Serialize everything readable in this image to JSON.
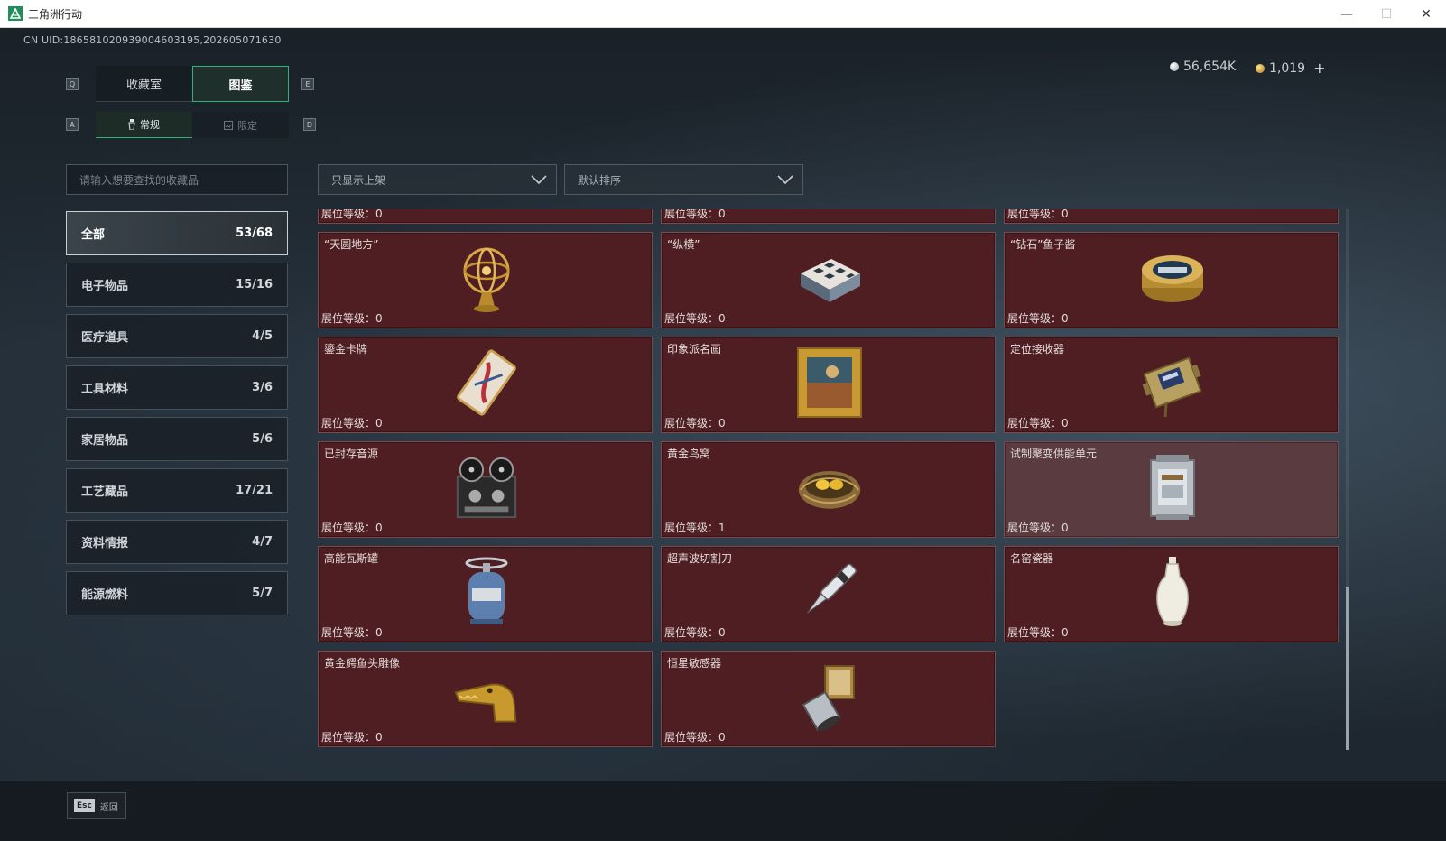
{
  "window": {
    "title": "三角洲行动",
    "minimize": "—",
    "maximize": "☐",
    "close": "✕"
  },
  "uid_text": "CN UID:18658102093900460319​5,202605071630",
  "currency": {
    "silver": "56,654K",
    "gold": "1,019",
    "add": "+"
  },
  "keys": {
    "q": "Q",
    "e": "E",
    "a": "A",
    "d": "D"
  },
  "tabs": [
    {
      "label": "收藏室"
    },
    {
      "label": "图鉴"
    }
  ],
  "subtabs": [
    {
      "label": "常规"
    },
    {
      "label": "限定"
    }
  ],
  "search": {
    "placeholder": "请输入想要查找的收藏品"
  },
  "filters": {
    "display": "只显示上架",
    "sort": "默认排序"
  },
  "categories": [
    {
      "label": "全部",
      "count": "53/68"
    },
    {
      "label": "电子物品",
      "count": "15/16"
    },
    {
      "label": "医疗道具",
      "count": "4/5"
    },
    {
      "label": "工具材料",
      "count": "3/6"
    },
    {
      "label": "家居物品",
      "count": "5/6"
    },
    {
      "label": "工艺藏品",
      "count": "17/21"
    },
    {
      "label": "资料情报",
      "count": "4/7"
    },
    {
      "label": "能源燃料",
      "count": "5/7"
    }
  ],
  "level_label": "展位等级：",
  "top_partial_levels": [
    "0",
    "0",
    "0"
  ],
  "items": [
    {
      "name": "“天圆地方”",
      "level": "0",
      "icon": "armillary-sphere-icon"
    },
    {
      "name": "“纵横”",
      "level": "0",
      "icon": "chess-box-icon"
    },
    {
      "name": "“钻石”鱼子酱",
      "level": "0",
      "icon": "caviar-tin-icon"
    },
    {
      "name": "鎏金卡牌",
      "level": "0",
      "icon": "gilded-card-icon"
    },
    {
      "name": "印象派名画",
      "level": "0",
      "icon": "framed-painting-icon"
    },
    {
      "name": "定位接收器",
      "level": "0",
      "icon": "locator-receiver-icon"
    },
    {
      "name": "已封存音源",
      "level": "0",
      "icon": "reel-recorder-icon"
    },
    {
      "name": "黄金鸟窝",
      "level": "1",
      "icon": "golden-nest-icon"
    },
    {
      "name": "试制聚变供能单元",
      "level": "0",
      "icon": "fusion-cell-icon"
    },
    {
      "name": "高能瓦斯罐",
      "level": "0",
      "icon": "gas-canister-icon"
    },
    {
      "name": "超声波切割刀",
      "level": "0",
      "icon": "ultrasonic-knife-icon"
    },
    {
      "name": "名窑瓷器",
      "level": "0",
      "icon": "porcelain-vase-icon"
    },
    {
      "name": "黄金鳄鱼头雕像",
      "level": "0",
      "icon": "crocodile-statue-icon"
    },
    {
      "name": "恒星敏感器",
      "level": "0",
      "icon": "star-sensor-icon"
    }
  ],
  "bottom": {
    "esc_key": "Esc",
    "back_label": "返回"
  }
}
